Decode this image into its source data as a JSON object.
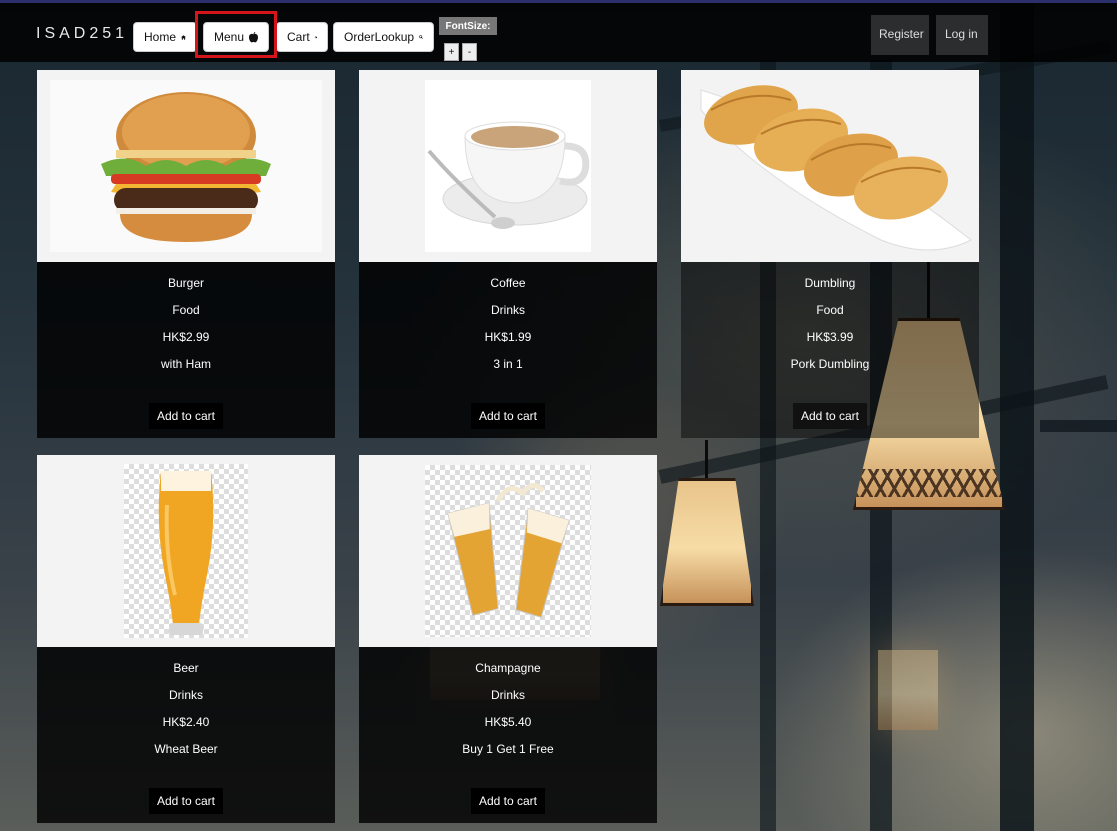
{
  "brand": "ISAD251",
  "nav": {
    "home": "Home",
    "menu": "Menu",
    "cart": "Cart",
    "order_lookup": "OrderLookup",
    "font_size_label": "FontSize:",
    "font_plus": "+",
    "font_minus": "-",
    "register": "Register",
    "login": "Log in"
  },
  "icons": {
    "home": "home-icon",
    "menu": "apple-icon",
    "cart": "cart-icon",
    "order_lookup": "search-icon"
  },
  "products": [
    {
      "name": "Burger",
      "category": "Food",
      "price": "HK$2.99",
      "description": "with Ham",
      "button": "Add to cart"
    },
    {
      "name": "Coffee",
      "category": "Drinks",
      "price": "HK$1.99",
      "description": "3 in 1",
      "button": "Add to cart"
    },
    {
      "name": "Dumbling",
      "category": "Food",
      "price": "HK$3.99",
      "description": "Pork Dumbling",
      "button": "Add to cart"
    },
    {
      "name": "Beer",
      "category": "Drinks",
      "price": "HK$2.40",
      "description": "Wheat Beer",
      "button": "Add to cart"
    },
    {
      "name": "Champagne",
      "category": "Drinks",
      "price": "HK$5.40",
      "description": "Buy 1 Get 1 Free",
      "button": "Add to cart"
    }
  ],
  "colors": {
    "highlight": "#d6141c",
    "topbar": "#000000",
    "card_bg": "#000000",
    "image_bg": "#f3f3f3"
  }
}
